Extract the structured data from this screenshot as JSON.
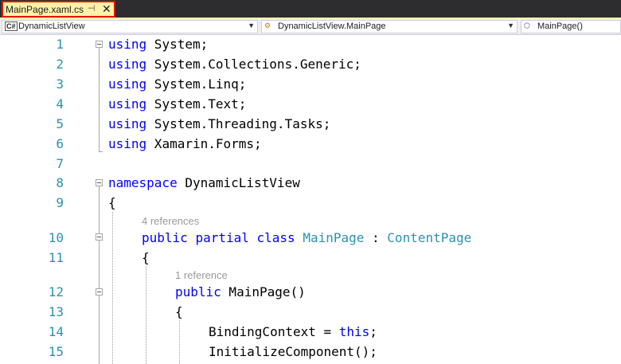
{
  "tab": {
    "filename": "MainPage.xaml.cs",
    "pin_glyph": "⊣",
    "close_glyph": "✕"
  },
  "navbar": {
    "project": "DynamicListView",
    "type": "DynamicListView.MainPage",
    "member": "MainPage()",
    "project_icon": "csharp-file-icon",
    "type_icon": "class-icon",
    "member_icon": "method-icon"
  },
  "lens": {
    "class_refs": "4 references",
    "ctor_refs": "1 reference"
  },
  "code": {
    "l1": {
      "num": "1",
      "kw": "using",
      "rest": " System;"
    },
    "l2": {
      "num": "2",
      "kw": "using",
      "rest": " System.Collections.Generic;"
    },
    "l3": {
      "num": "3",
      "kw": "using",
      "rest": " System.Linq;"
    },
    "l4": {
      "num": "4",
      "kw": "using",
      "rest": " System.Text;"
    },
    "l5": {
      "num": "5",
      "kw": "using",
      "rest": " System.Threading.Tasks;"
    },
    "l6": {
      "num": "6",
      "kw": "using",
      "rest": " Xamarin.Forms;"
    },
    "l7": {
      "num": "7"
    },
    "l8": {
      "num": "8",
      "kw": "namespace",
      "rest": " DynamicListView"
    },
    "l9": {
      "num": "9",
      "text": "{"
    },
    "l10": {
      "num": "10",
      "kw1": "public",
      "kw2": "partial",
      "kw3": "class",
      "type1": "MainPage",
      "sep": " : ",
      "type2": "ContentPage"
    },
    "l11": {
      "num": "11",
      "text": "{"
    },
    "l12": {
      "num": "12",
      "kw": "public",
      "rest": " MainPage()"
    },
    "l13": {
      "num": "13",
      "text": "{"
    },
    "l14": {
      "num": "14",
      "pre": "BindingContext = ",
      "kw": "this",
      "post": ";"
    },
    "l15": {
      "num": "15",
      "text": "InitializeComponent();"
    }
  },
  "colors": {
    "keyword": "#0000ff",
    "type": "#2b91af",
    "line_number": "#2b91af",
    "tab_bg": "#fff1a8",
    "tab_highlight_border": "#e51400",
    "tabstrip_bg": "#2d2d30"
  }
}
